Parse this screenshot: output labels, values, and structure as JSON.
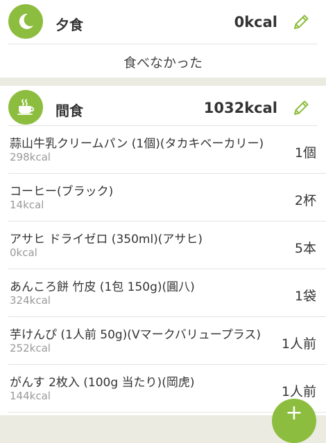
{
  "colors": {
    "accent": "#8dbd3f",
    "background": "#ebebe1"
  },
  "dinner": {
    "icon": "moon-icon",
    "title": "夕食",
    "kcal": "0kcal",
    "empty_text": "食べなかった"
  },
  "snack": {
    "icon": "coffee-cup-icon",
    "title": "間食",
    "kcal": "1032kcal",
    "items": [
      {
        "name": "蒜山牛乳クリームパン (1個)(タカキベーカリー)",
        "kcal": "298kcal",
        "qty": "1個"
      },
      {
        "name": "コーヒー(ブラック)",
        "kcal": "14kcal",
        "qty": "2杯"
      },
      {
        "name": "アサヒ ドライゼロ (350ml)(アサヒ)",
        "kcal": "0kcal",
        "qty": "5本"
      },
      {
        "name": "あんころ餅 竹皮 (1包 150g)(圓八)",
        "kcal": "324kcal",
        "qty": "1袋"
      },
      {
        "name": "芋けんぴ (1人前 50g)(Vマークバリュープラス)",
        "kcal": "252kcal",
        "qty": "1人前"
      },
      {
        "name": "がんす 2枚入 (100g 当たり)(岡虎)",
        "kcal": "144kcal",
        "qty": "1人前"
      }
    ]
  },
  "fab": {
    "icon": "plus-icon",
    "label": "+"
  }
}
